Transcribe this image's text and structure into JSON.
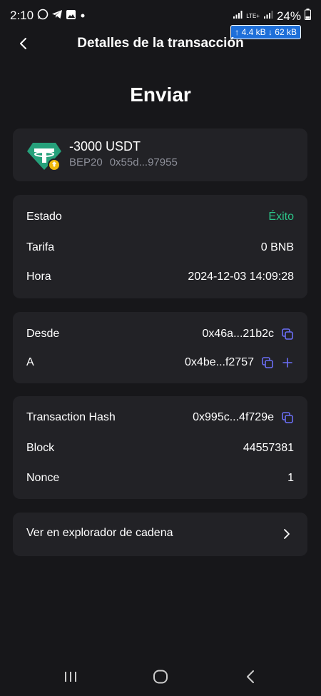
{
  "status_bar": {
    "time": "2:10",
    "battery": "24%",
    "network_label": "LTE+",
    "net_speed": "↑ 4.4 kB ↓ 62 kB"
  },
  "header": {
    "title": "Detalles de la transacción"
  },
  "page": {
    "heading": "Enviar"
  },
  "token": {
    "amount": "-3000 USDT",
    "network": "BEP20",
    "address": "0x55d...97955",
    "icon": "tether-usdt-icon"
  },
  "status_card": {
    "rows": [
      {
        "label": "Estado",
        "value": "Éxito"
      },
      {
        "label": "Tarifa",
        "value": "0 BNB"
      },
      {
        "label": "Hora",
        "value": "2024-12-03 14:09:28"
      }
    ]
  },
  "address_card": {
    "from_label": "Desde",
    "from_value": "0x46a...21b2c",
    "to_label": "A",
    "to_value": "0x4be...f2757"
  },
  "hash_card": {
    "rows": [
      {
        "label": "Transaction Hash",
        "value": "0x995c...4f729e"
      },
      {
        "label": "Block",
        "value": "44557381"
      },
      {
        "label": "Nonce",
        "value": "1"
      }
    ]
  },
  "explorer": {
    "label": "Ver en explorador de cadena"
  },
  "colors": {
    "background": "#17171a",
    "card": "#222226",
    "success": "#2cc68a",
    "accent": "#6b6ef5",
    "muted": "#8d8f99"
  }
}
